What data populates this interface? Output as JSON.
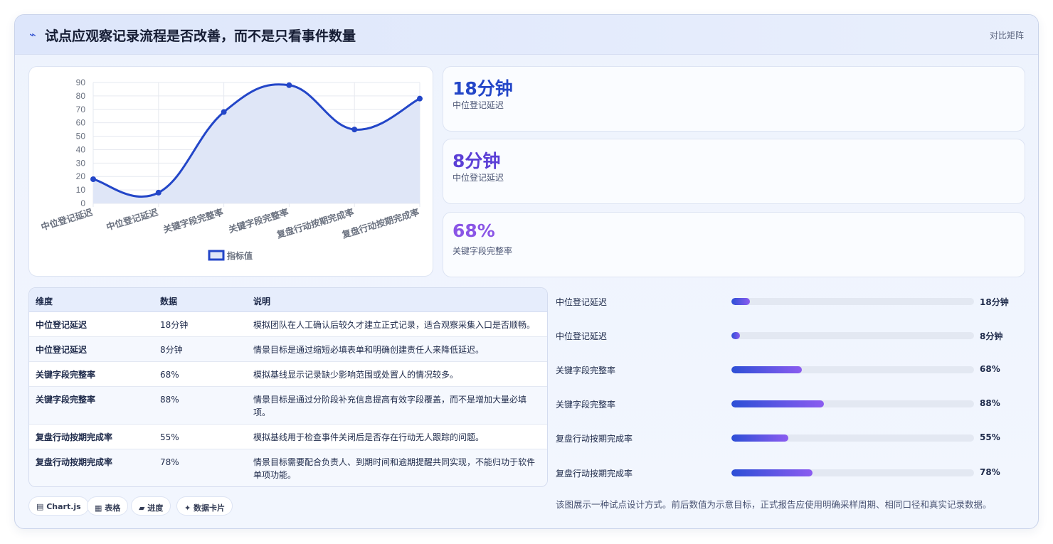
{
  "header": {
    "icon": "trend-icon",
    "title": "试点应观察记录流程是否改善，而不是只看事件数量",
    "right_label": "对比矩阵"
  },
  "chart_data": {
    "type": "line",
    "categories": [
      "中位登记延迟",
      "中位登记延迟",
      "关键字段完整率",
      "关键字段完整率",
      "复盘行动按期完成率",
      "复盘行动按期完成率"
    ],
    "series": [
      {
        "name": "指标值",
        "values": [
          18,
          8,
          68,
          88,
          55,
          78
        ]
      }
    ],
    "ylim": [
      0,
      90
    ],
    "yticks": [
      0,
      10,
      20,
      30,
      40,
      50,
      60,
      70,
      80,
      90
    ],
    "legend": "bottom",
    "grid": true,
    "line_color": "#2346c8",
    "fill_color": "#dfe6f7"
  },
  "stats": [
    {
      "value": "18分钟",
      "label": "中位登记延迟",
      "color": "#2346c8"
    },
    {
      "value": "8分钟",
      "label": "中位登记延迟",
      "color": "#5b3fd6"
    },
    {
      "value": "68%",
      "label": "关键字段完整率",
      "color": "#8a55e6"
    }
  ],
  "table": {
    "headers": [
      "维度",
      "数据",
      "说明"
    ],
    "rows": [
      {
        "dim": "中位登记延迟",
        "data": "18分钟",
        "note": "模拟团队在人工确认后较久才建立正式记录，适合观察采集入口是否顺畅。"
      },
      {
        "dim": "中位登记延迟",
        "data": "8分钟",
        "note": "情景目标是通过缩短必填表单和明确创建责任人来降低延迟。"
      },
      {
        "dim": "关键字段完整率",
        "data": "68%",
        "note": "模拟基线显示记录缺少影响范围或处置人的情况较多。"
      },
      {
        "dim": "关键字段完整率",
        "data": "88%",
        "note": "情景目标是通过分阶段补充信息提高有效字段覆盖，而不是增加大量必填项。"
      },
      {
        "dim": "复盘行动按期完成率",
        "data": "55%",
        "note": "模拟基线用于检查事件关闭后是否存在行动无人跟踪的问题。"
      },
      {
        "dim": "复盘行动按期完成率",
        "data": "78%",
        "note": "情景目标需要配合负责人、到期时间和逾期提醒共同实现，不能归功于软件单项功能。"
      }
    ]
  },
  "tags": [
    "▤ Chart.js",
    "▦ 表格",
    "▰ 进度",
    "✦ 数据卡片"
  ],
  "progress": [
    {
      "label": "中位登记延迟",
      "value": "18分钟",
      "fraction": 0.075
    },
    {
      "label": "中位登记延迟",
      "value": "8分钟",
      "fraction": 0.035
    },
    {
      "label": "关键字段完整率",
      "value": "68%",
      "fraction": 0.29
    },
    {
      "label": "关键字段完整率",
      "value": "88%",
      "fraction": 0.38
    },
    {
      "label": "复盘行动按期完成率",
      "value": "55%",
      "fraction": 0.235
    },
    {
      "label": "复盘行动按期完成率",
      "value": "78%",
      "fraction": 0.335
    }
  ],
  "footnote": "该图展示一种试点设计方式。前后数值为示意目标，正式报告应使用明确采样周期、相同口径和真实记录数据。"
}
